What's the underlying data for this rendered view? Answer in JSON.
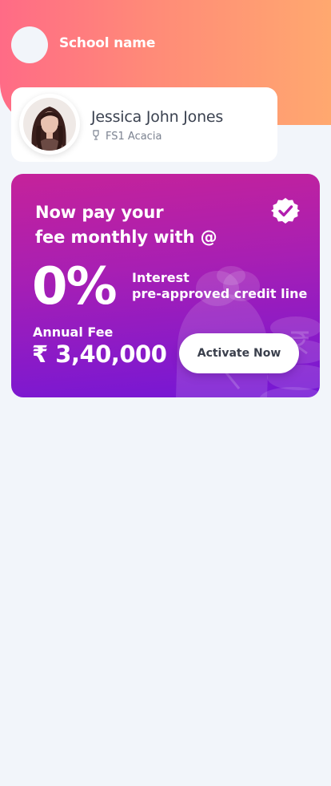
{
  "header": {
    "school_name": "School name",
    "gradient": [
      "#ff6b86",
      "#ffa86f"
    ]
  },
  "student": {
    "name": "Jessica John Jones",
    "class": "FS1 Acacia",
    "class_icon": "trophy-icon"
  },
  "promo": {
    "headline_line1": "Now pay your",
    "headline_line2": "fee monthly with @",
    "rate": "0%",
    "interest_line1": "Interest",
    "interest_line2": "pre-approved credit line",
    "fee_label": "Annual Fee",
    "fee_amount": "₹ 3,40,000",
    "cta_label": "Activate Now",
    "badge_icon": "verified-check-icon",
    "gradient": [
      "#c5229a",
      "#7417d6"
    ]
  }
}
